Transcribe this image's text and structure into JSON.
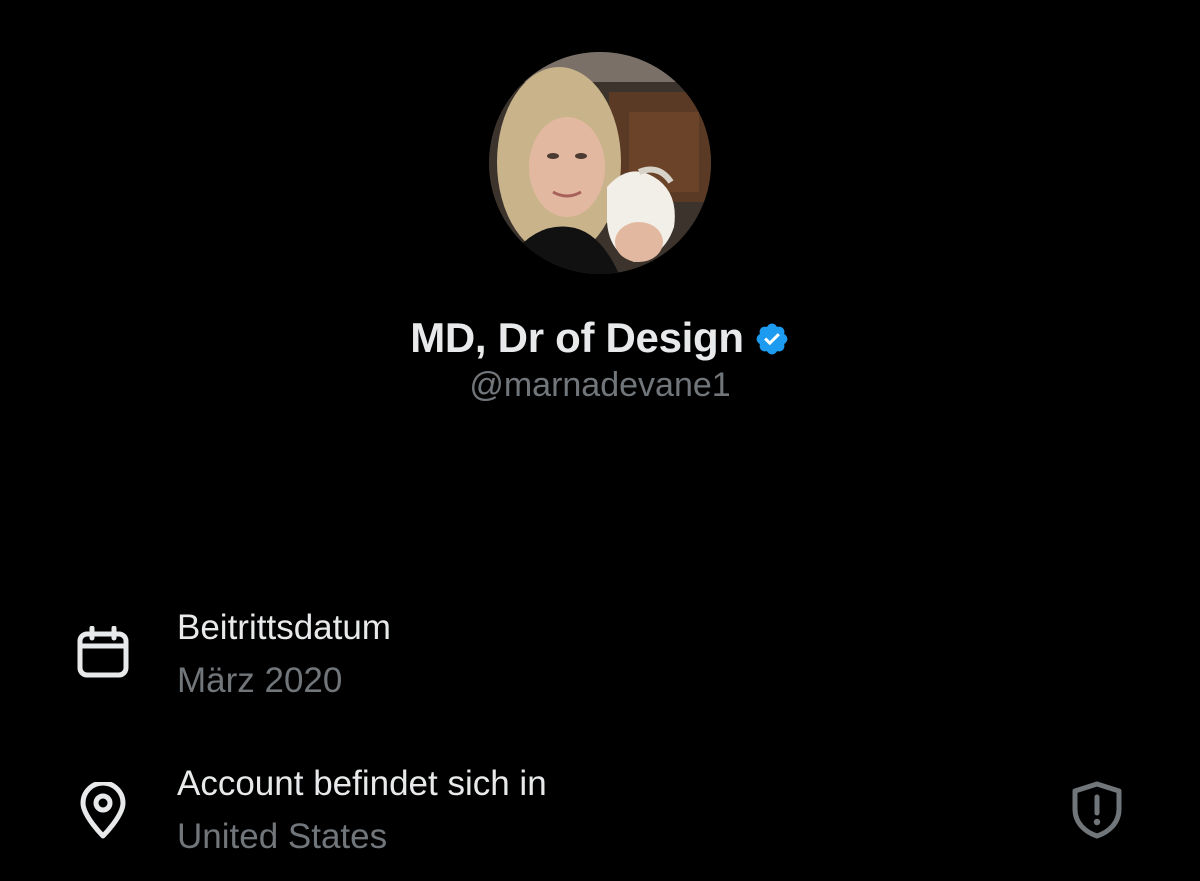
{
  "profile": {
    "display_name": "MD, Dr of Design",
    "handle": "@marnadevane1",
    "verified": true,
    "verified_color": "#1d9bf0"
  },
  "about": {
    "joined": {
      "icon": "calendar-icon",
      "title": "Beitrittsdatum",
      "value": "März 2020"
    },
    "location": {
      "icon": "location-pin-icon",
      "title": "Account befindet sich in",
      "value": "United States",
      "trailing_icon": "shield-alert-icon"
    }
  },
  "colors": {
    "background": "#000000",
    "primary_text": "#e7e9ea",
    "secondary_text": "#71767b"
  }
}
